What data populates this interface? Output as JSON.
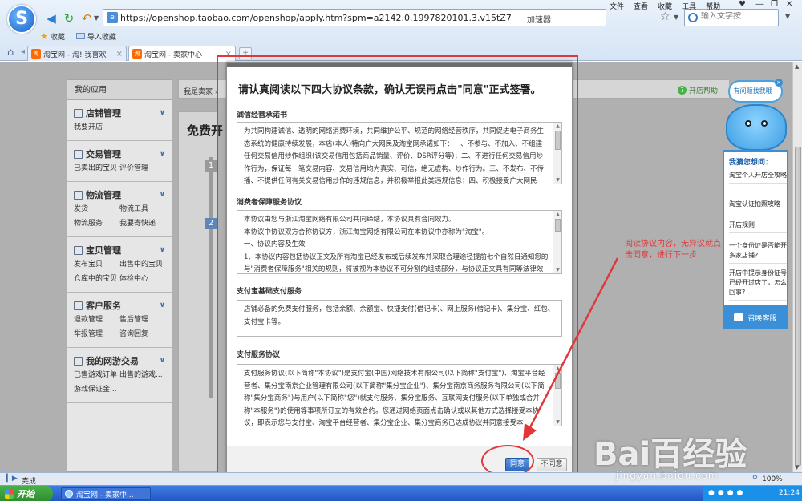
{
  "browser": {
    "logo_letter": "S",
    "url": "https://openshop.taobao.com/openshop/apply.htm?spm=a2142.0.1997820101.3.v15tZ7",
    "accelerator": "加速器",
    "search_placeholder": "输入文字按",
    "menus": [
      "文件",
      "查看",
      "收藏",
      "工具",
      "帮助"
    ],
    "favorites": [
      {
        "label": "收藏"
      },
      {
        "label": "导入收藏"
      }
    ],
    "tabs": [
      {
        "favicon": "淘",
        "label": "淘宝网 - 淘! 我喜欢",
        "active": false
      },
      {
        "favicon": "淘",
        "label": "淘宝网 - 卖家中心",
        "active": true
      }
    ],
    "new_tab": "+"
  },
  "left_menu": {
    "title": "我的应用",
    "groups": [
      {
        "title": "店铺管理",
        "icon": "shop-icon",
        "links": [
          "我要开店"
        ]
      },
      {
        "title": "交易管理",
        "icon": "trade-icon",
        "links": [
          "已卖出的宝贝",
          "评价管理"
        ]
      },
      {
        "title": "物流管理",
        "icon": "truck-icon",
        "links": [
          "发货",
          "物流工具",
          "物流服务",
          "我要寄快递"
        ]
      },
      {
        "title": "宝贝管理",
        "icon": "shirt-icon",
        "links": [
          "发布宝贝",
          "出售中的宝贝",
          "仓库中的宝贝",
          "体检中心"
        ]
      },
      {
        "title": "客户服务",
        "icon": "service-icon",
        "links": [
          "退款管理",
          "售后管理",
          "举报管理",
          "咨询回复"
        ]
      },
      {
        "title": "我的网游交易",
        "icon": "game-icon",
        "links": [
          "已售游戏订单",
          "出售的游戏...",
          "游戏保证金..."
        ]
      }
    ]
  },
  "seller": {
    "crumb": "我是卖家 ›",
    "help": "开店帮助",
    "free_title": "免费开",
    "steps": [
      "1",
      "2"
    ]
  },
  "dialog": {
    "header": "请认真阅读以下四大协议条款，确认无误再点击\"同意\"正式签署。",
    "sections": [
      {
        "title": "诚信经营承诺书",
        "text": "为共同构建诚信、透明的网络消费环境，共同维护公平、规范的网络经营秩序，共同促进电子商务生态系统的健康持续发展，本店(本人)特向广大网民及淘宝网承诺如下：一、不参与、不加入、不组建任何交易信用炒作组织(该交易信用包括商品销量、评价、DSR评分等)；二、不进行任何交易信用炒作行为，保证每一笔交易内容、交易信用均为真实、可信，绝无虚构、炒作行为。三、不发布、不传播、不提供任何有关交易信用炒作的违规信息，并积极举报此类违规信息；四、积极接受广大网民"
      },
      {
        "title": "消费者保障服务协议",
        "text": "本协议由您与浙江淘宝网络有限公司共同缔结，本协议具有合同效力。\n本协议中协议双方合称协议方，浙江淘宝网络有限公司在本协议中亦称为\"淘宝\"。\n一、协议内容及生效\n1、本协议内容包括协议正文及所有淘宝已经发布或后续发布并采取合理途径提前七个自然日通知您的与\"消费者保障服务\"相关的规则，将被视为本协议不可分割的组成部分，与协议正文具有同等法律效"
      },
      {
        "title": "支付宝基础支付服务",
        "text": "店铺必备的免费支付服务，包括余额、余额宝、快捷支付(借记卡)、网上服务(借记卡)、集分宝、红包、支付宝卡等。"
      },
      {
        "title": "支付服务协议",
        "text": "支付服务协议(以下简称\"本协议\")是支付宝(中国)网络技术有限公司(以下简称\"支付宝\")、淘宝平台经营者、集分宝南京企业管理有限公司(以下简称\"集分宝企业\")、集分宝南京商务服务有限公司(以下简称\"集分宝商务\")与用户(以下简称\"您\")就支付服务、集分宝服务、互联网支付服务(以下单独或合并称\"本服务\")的使用等事项所订立的有效合约。您通过网络页面点击确认或以其他方式选择接受本协议，即表示您与支付宝、淘宝平台经营者、集分宝企业、集分宝商务已达成协议并同意接受本"
      }
    ],
    "agree": "同意",
    "disagree": "不同意"
  },
  "annotation": {
    "text": "阅读协议内容，无异议就点击同意，进行下一步"
  },
  "helper": {
    "bubble": "有问题找我哦~",
    "title": "我猜您想问：",
    "items": [
      "淘宝个人开店全攻略",
      "淘宝认证拍照攻略",
      "开店规则",
      "一个身份证是否能开多家店铺?",
      "开店中提示身份证号已经开过店了，怎么回事?"
    ],
    "service": "召唤客服"
  },
  "statusbar": {
    "text": "完成",
    "zoom": "100%"
  },
  "taskbar": {
    "start": "开始",
    "item": "淘宝网 - 卖家中...",
    "clock": "21:24"
  },
  "watermark": {
    "logo": "Bai百经验",
    "sub": "jingyan.baidu.com"
  },
  "colors": {
    "annotation": "#e2373a",
    "agree_button": "#2e6cc2",
    "helper_accent": "#3b8fd6"
  }
}
